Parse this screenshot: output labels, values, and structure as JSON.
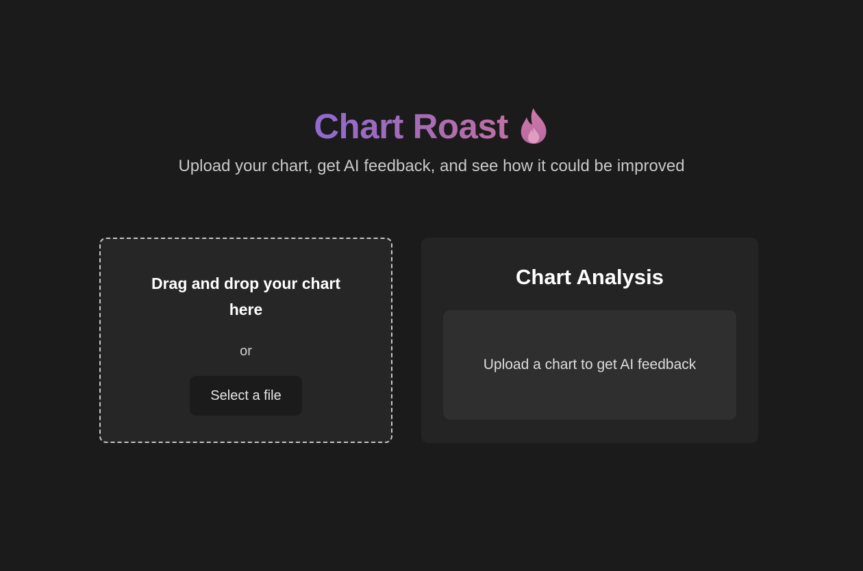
{
  "header": {
    "title": "Chart Roast",
    "title_icon": "flame-icon",
    "subtitle": "Upload your chart, get AI feedback, and see how it could be improved",
    "title_gradient": [
      "#8f6ad0",
      "#c070a4"
    ]
  },
  "upload": {
    "heading": "Drag and drop your chart here",
    "or_text": "or",
    "button_label": "Select a file"
  },
  "analysis": {
    "title": "Chart Analysis",
    "placeholder": "Upload a chart to get AI feedback"
  },
  "colors": {
    "background": "#1b1b1b",
    "panel": "#262626",
    "inner_panel": "#2f2f2f"
  }
}
